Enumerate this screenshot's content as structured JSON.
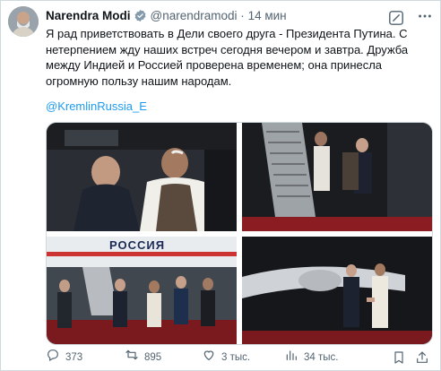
{
  "tweet": {
    "author_name": "Narendra Modi",
    "handle": "@narendramodi",
    "separator": "·",
    "time": "14 мин",
    "text": "Я рад приветствовать в Дели своего друга - Президента Путина. С нетерпением жду наших встреч сегодня вечером и завтра. Дружба между Индией и Россией проверена временем; она принесла огромную пользу нашим народам.",
    "mention": "@KremlinRussia_E",
    "plane_lettering": "РОССИЯ"
  },
  "actions": {
    "replies": "373",
    "reposts": "895",
    "likes": "3 тыс.",
    "views": "34 тыс."
  },
  "colors": {
    "accent": "#1d9bf0",
    "secondary_text": "#536471",
    "border": "#cfd9de"
  },
  "icons": [
    "verified-badge-icon",
    "grok-icon",
    "more-icon",
    "reply-icon",
    "repost-icon",
    "like-icon",
    "views-icon",
    "bookmark-icon",
    "share-icon"
  ]
}
